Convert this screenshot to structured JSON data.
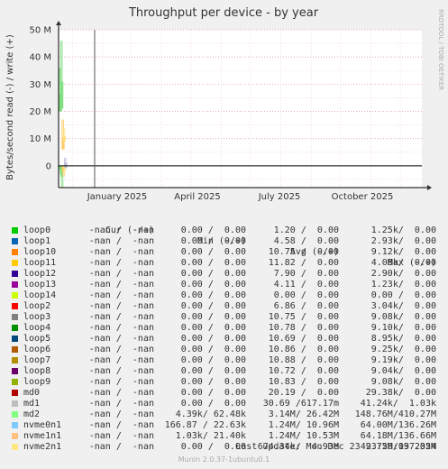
{
  "chart_data": {
    "type": "line",
    "title": "Throughput per device - by year",
    "ylabel": "Bytes/second read (-) / write (+)",
    "side_label": "RRDTOOL / TOBI OETIKER",
    "y_ticks": [
      {
        "value": 50000000,
        "label": "50 M"
      },
      {
        "value": 40000000,
        "label": "40 M"
      },
      {
        "value": 30000000,
        "label": "30 M"
      },
      {
        "value": 20000000,
        "label": "20 M"
      },
      {
        "value": 10000000,
        "label": "10 M"
      },
      {
        "value": 0,
        "label": "0"
      }
    ],
    "ylim": [
      -8000000,
      50000000
    ],
    "xlim": [
      "2023-12-18",
      "2024-12-23"
    ],
    "x_ticks": [
      {
        "value": "2025-01-01",
        "label": "January 2025"
      },
      {
        "value": "2025-04-01",
        "label": "April 2025"
      },
      {
        "value": "2025-07-01",
        "label": "July 2025"
      },
      {
        "value": "2025-10-01",
        "label": "October 2025"
      }
    ],
    "grid": true,
    "marker": {
      "date": "2024-12-23",
      "color": "#555555"
    },
    "bursts": [
      {
        "series": "md2",
        "color": "#7ee07e",
        "day_offset": 1,
        "write_max": 46000000,
        "write_min": 21000000,
        "read_min": -8000000
      },
      {
        "series": "md2",
        "color": "#7ee07e",
        "day_offset": 0,
        "write_max": 36000000,
        "write_min": 20000000,
        "read_min": -3000000
      },
      {
        "series": "nvme1n1",
        "color": "#ffc860",
        "day_offset": 2,
        "write_max": 17000000,
        "write_min": 6000000,
        "read_min": -4000000
      },
      {
        "series": "nvme2n1",
        "color": "#ffe080",
        "day_offset": 3,
        "write_max": 14000000,
        "write_min": 9000000,
        "read_min": -2000000
      },
      {
        "series": "md1",
        "color": "#b8b8d8",
        "day_offset": 4,
        "write_max": 3000000,
        "write_min": 0,
        "read_min": -1000000
      }
    ]
  },
  "legend": {
    "headers": {
      "cur": "Cur (-/+)",
      "min": "Min (-/+)",
      "avg": "Avg (-/+)",
      "max": "Max (-/+)"
    },
    "rows": [
      {
        "name": "loop0",
        "color": "#00cc00",
        "cur": "-nan /  -nan",
        "min": "0.00 /  0.00",
        "avg": "1.20 /  0.00",
        "max": "1.25k/  0.00"
      },
      {
        "name": "loop1",
        "color": "#0066b3",
        "cur": "-nan /  -nan",
        "min": "0.00 /  0.00",
        "avg": "4.58 /  0.00",
        "max": "2.93k/  0.00"
      },
      {
        "name": "loop10",
        "color": "#ff8000",
        "cur": "-nan /  -nan",
        "min": "0.00 /  0.00",
        "avg": "10.75 /  0.00",
        "max": "9.12k/  0.00"
      },
      {
        "name": "loop11",
        "color": "#ffcc00",
        "cur": "-nan /  -nan",
        "min": "0.00 /  0.00",
        "avg": "11.82 /  0.00",
        "max": "4.08k/  0.00"
      },
      {
        "name": "loop12",
        "color": "#330099",
        "cur": "-nan /  -nan",
        "min": "0.00 /  0.00",
        "avg": "7.90 /  0.00",
        "max": "2.90k/  0.00"
      },
      {
        "name": "loop13",
        "color": "#990099",
        "cur": "-nan /  -nan",
        "min": "0.00 /  0.00",
        "avg": "4.11 /  0.00",
        "max": "1.23k/  0.00"
      },
      {
        "name": "loop14",
        "color": "#ccff00",
        "cur": "-nan /  -nan",
        "min": "0.00 /  0.00",
        "avg": "0.00 /  0.00",
        "max": "0.00 /  0.00"
      },
      {
        "name": "loop2",
        "color": "#ff0000",
        "cur": "-nan /  -nan",
        "min": "0.00 /  0.00",
        "avg": "6.86 /  0.00",
        "max": "3.04k/  0.00"
      },
      {
        "name": "loop3",
        "color": "#808080",
        "cur": "-nan /  -nan",
        "min": "0.00 /  0.00",
        "avg": "10.75 /  0.00",
        "max": "9.08k/  0.00"
      },
      {
        "name": "loop4",
        "color": "#008f00",
        "cur": "-nan /  -nan",
        "min": "0.00 /  0.00",
        "avg": "10.78 /  0.00",
        "max": "9.10k/  0.00"
      },
      {
        "name": "loop5",
        "color": "#00487d",
        "cur": "-nan /  -nan",
        "min": "0.00 /  0.00",
        "avg": "10.69 /  0.00",
        "max": "8.95k/  0.00"
      },
      {
        "name": "loop6",
        "color": "#b35a00",
        "cur": "-nan /  -nan",
        "min": "0.00 /  0.00",
        "avg": "10.86 /  0.00",
        "max": "9.25k/  0.00"
      },
      {
        "name": "loop7",
        "color": "#b38f00",
        "cur": "-nan /  -nan",
        "min": "0.00 /  0.00",
        "avg": "10.88 /  0.00",
        "max": "9.19k/  0.00"
      },
      {
        "name": "loop8",
        "color": "#6b006b",
        "cur": "-nan /  -nan",
        "min": "0.00 /  0.00",
        "avg": "10.72 /  0.00",
        "max": "9.04k/  0.00"
      },
      {
        "name": "loop9",
        "color": "#8fb300",
        "cur": "-nan /  -nan",
        "min": "0.00 /  0.00",
        "avg": "10.83 /  0.00",
        "max": "9.08k/  0.00"
      },
      {
        "name": "md0",
        "color": "#b30000",
        "cur": "-nan /  -nan",
        "min": "0.00 /  0.00",
        "avg": "20.19 /  0.00",
        "max": "29.38k/  0.00"
      },
      {
        "name": "md1",
        "color": "#bebebe",
        "cur": "-nan /  -nan",
        "min": "0.00 /  0.00",
        "avg": "30.69 /617.17m",
        "max": "41.24k/  1.03k"
      },
      {
        "name": "md2",
        "color": "#80ff80",
        "cur": "-nan /  -nan",
        "min": "4.39k/ 62.48k",
        "avg": "3.14M/ 26.42M",
        "max": "148.76M/410.27M"
      },
      {
        "name": "nvme0n1",
        "color": "#80c9ff",
        "cur": "-nan /  -nan",
        "min": "166.87 / 22.63k",
        "avg": "1.24M/ 10.96M",
        "max": "64.00M/136.26M"
      },
      {
        "name": "nvme1n1",
        "color": "#ffc080",
        "cur": "-nan /  -nan",
        "min": "1.03k/ 21.40k",
        "avg": "1.24M/ 10.53M",
        "max": "64.18M/136.66M"
      },
      {
        "name": "nvme2n1",
        "color": "#ffe680",
        "cur": "-nan /  -nan",
        "min": "0.00 /  0.00",
        "avg": "674.34k/  4.93M",
        "max": "49.75M/137.35M"
      }
    ]
  },
  "last_update": "Last update: Mon Dec 23 23:20:09 2024",
  "footer": "Munin 2.0.37-1ubuntu0.1"
}
